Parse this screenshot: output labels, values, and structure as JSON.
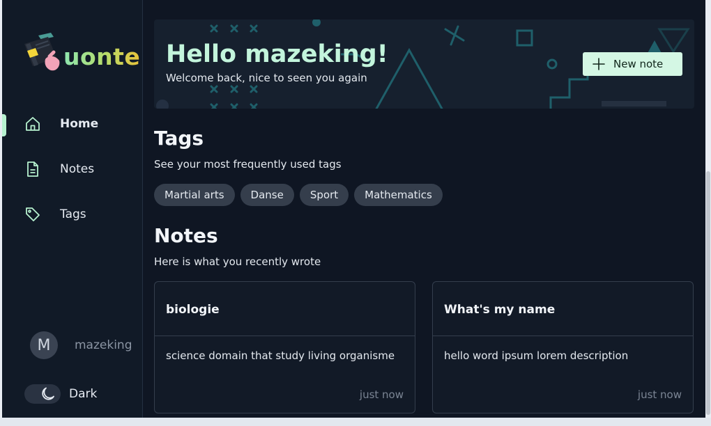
{
  "app": {
    "logo_text": "uonte"
  },
  "sidebar": {
    "items": [
      {
        "label": "Home",
        "icon": "home-icon",
        "active": true
      },
      {
        "label": "Notes",
        "icon": "note-icon",
        "active": false
      },
      {
        "label": "Tags",
        "icon": "tag-icon",
        "active": false
      }
    ],
    "user": {
      "initial": "M",
      "name": "mazeking"
    },
    "theme": {
      "label": "Dark",
      "icon": "moon-icon"
    }
  },
  "banner": {
    "title": "Hello mazeking!",
    "subtitle": "Welcome back, nice to seen you again",
    "new_note_label": "New note"
  },
  "tags_section": {
    "title": "Tags",
    "subtitle": "See your most frequently used tags",
    "tags": [
      "Martial arts",
      "Danse",
      "Sport",
      "Mathematics"
    ]
  },
  "notes_section": {
    "title": "Notes",
    "subtitle": "Here is what you recently wrote",
    "notes": [
      {
        "title": "biologie",
        "description": "science domain that study living organisme",
        "time": "just now"
      },
      {
        "title": "What's my name",
        "description": "hello word ipsum lorem description",
        "time": "just now"
      }
    ]
  },
  "colors": {
    "accent": "#c3f5dc",
    "background": "#0f1623",
    "sidebar": "#111a27",
    "button": "#d4f7e4",
    "decoration": "#1f5f6a"
  }
}
